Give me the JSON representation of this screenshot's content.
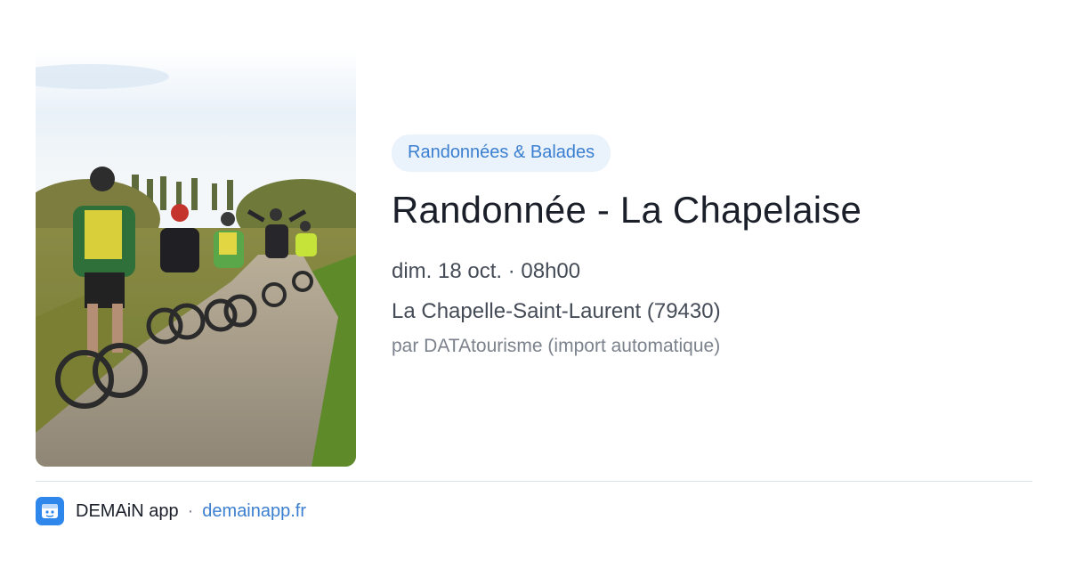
{
  "event": {
    "category": "Randonnées & Balades",
    "title": "Randonnée - La Chapelaise",
    "date": "dim. 18 oct. · 08h00",
    "location": "La Chapelle-Saint-Laurent (79430)",
    "source": "par DATAtourisme (import automatique)"
  },
  "image": {
    "icon": "cyclists-photo"
  },
  "footer": {
    "app_name": "DEMAiN app",
    "separator": "·",
    "url": "demainapp.fr",
    "icon": "demain-app-icon"
  },
  "colors": {
    "accent": "#3b7fd0",
    "badge_bg": "#eaf2fb",
    "title": "#1a1f29",
    "text": "#454c57",
    "muted": "#7b828c",
    "app_icon_bg": "#2f87ec"
  }
}
